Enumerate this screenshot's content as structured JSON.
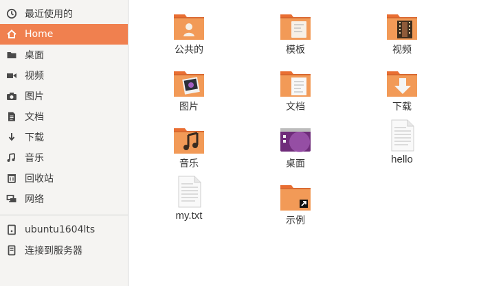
{
  "sidebar": {
    "items": [
      {
        "label": "最近使用的",
        "icon": "clock-icon",
        "active": false
      },
      {
        "label": "Home",
        "icon": "home-icon",
        "active": true
      },
      {
        "label": "桌面",
        "icon": "folder-icon",
        "active": false
      },
      {
        "label": "视频",
        "icon": "video-camera-icon",
        "active": false
      },
      {
        "label": "图片",
        "icon": "camera-icon",
        "active": false
      },
      {
        "label": "文档",
        "icon": "document-icon",
        "active": false
      },
      {
        "label": "下载",
        "icon": "download-arrow-icon",
        "active": false
      },
      {
        "label": "音乐",
        "icon": "music-note-icon",
        "active": false
      },
      {
        "label": "回收站",
        "icon": "trash-icon",
        "active": false
      },
      {
        "label": "网络",
        "icon": "network-icon",
        "active": false
      }
    ],
    "devices": [
      {
        "label": "ubuntu1604lts",
        "icon": "drive-icon"
      },
      {
        "label": "连接到服务器",
        "icon": "server-icon"
      }
    ]
  },
  "files": [
    {
      "label": "公共的",
      "icon": "folder-public-icon"
    },
    {
      "label": "模板",
      "icon": "folder-templates-icon"
    },
    {
      "label": "视频",
      "icon": "folder-videos-icon"
    },
    {
      "label": "图片",
      "icon": "folder-pictures-icon"
    },
    {
      "label": "文档",
      "icon": "folder-documents-icon"
    },
    {
      "label": "下载",
      "icon": "folder-downloads-icon"
    },
    {
      "label": "音乐",
      "icon": "folder-music-icon"
    },
    {
      "label": "桌面",
      "icon": "folder-desktop-icon"
    },
    {
      "label": "hello",
      "icon": "text-file-icon"
    },
    {
      "label": "my.txt",
      "icon": "text-file-icon"
    },
    {
      "label": "示例",
      "icon": "folder-link-icon"
    }
  ],
  "colors": {
    "accent": "#f0804f",
    "folder_top": "#e96e32",
    "folder_front": "#f29a57",
    "sidebar_bg": "#f5f4f2"
  }
}
